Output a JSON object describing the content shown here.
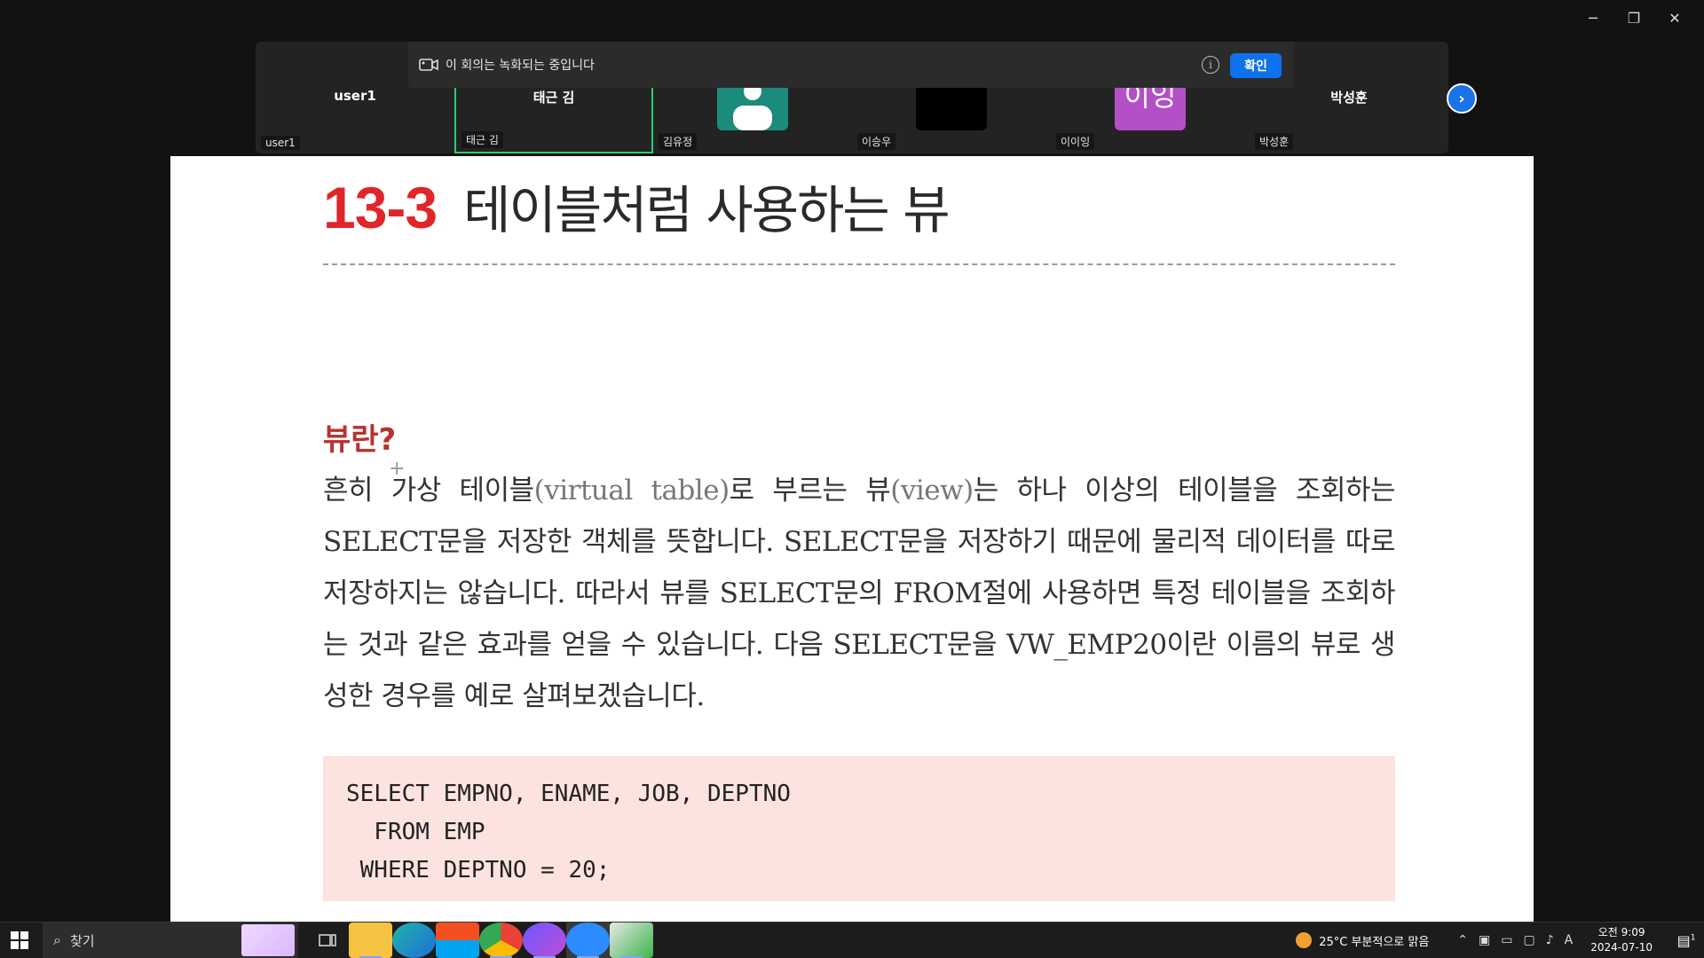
{
  "window": {
    "minimize": "─",
    "restore": "❐",
    "close": "✕"
  },
  "participants": [
    {
      "top": "user1",
      "bottom": "user1"
    },
    {
      "top": "태근 김",
      "bottom": "태근 김"
    },
    {
      "top": "",
      "bottom": "김유정"
    },
    {
      "top": "",
      "bottom": "이승우"
    },
    {
      "top": "",
      "avatar_text": "이잉",
      "bottom": "이이잉"
    },
    {
      "top": "박성훈",
      "bottom": "박성훈"
    }
  ],
  "banner": {
    "text": "이 회의는 녹화되는 중입니다",
    "info": "i",
    "confirm": "확인"
  },
  "next_icon": "›",
  "document": {
    "section_number": "13-3",
    "section_title": "테이블처럼 사용하는 뷰",
    "heading": "뷰란?",
    "para_1": "흔히 가상 테이블",
    "para_2": "(virtual table)",
    "para_3": "로 부르는 뷰",
    "para_4": "(view)",
    "para_5": "는 하나 이상의 테이블을 조회하는 SELECT문을 저장한 객체를 뜻합니다. SELECT문을 저장하기 때문에 물리적 데이터를 따로 저장하지는 않습니다. 따라서 뷰를 SELECT문의 FROM절에 사용하면 특정 테이블을 조회하는 것과 같은 효과를 얻을 수 있습니다. 다음 SELECT문을 VW_EMP20이란 이름의 뷰로 생성한 경우를 예로 살펴보겠습니다.",
    "code": "SELECT EMPNO, ENAME, JOB, DEPTNO\n  FROM EMP\n WHERE DEPTNO = 20;"
  },
  "taskbar": {
    "search_placeholder": "찾기",
    "weather": "25°C  부분적으로 맑음",
    "ime": "A",
    "time": "오전 9:09",
    "date": "2024-07-10",
    "notifications": "1"
  }
}
